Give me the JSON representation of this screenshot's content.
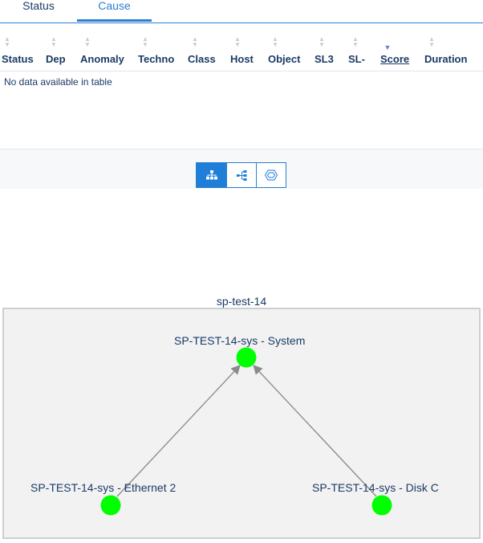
{
  "tabs": [
    {
      "label": "Status",
      "active": false
    },
    {
      "label": "Cause",
      "active": true
    }
  ],
  "table": {
    "columns": [
      {
        "label": "Status",
        "sorted": false
      },
      {
        "label": "Dep",
        "sorted": false
      },
      {
        "label": "Anomaly",
        "sorted": false
      },
      {
        "label": "Techno",
        "sorted": false
      },
      {
        "label": "Class",
        "sorted": false
      },
      {
        "label": "Host",
        "sorted": false
      },
      {
        "label": "Object",
        "sorted": false
      },
      {
        "label": "SL3",
        "sorted": false
      },
      {
        "label": "SL-",
        "sorted": false
      },
      {
        "label": "Score",
        "sorted": true
      },
      {
        "label": "Duration",
        "sorted": false
      }
    ],
    "empty_message": "No data available in table"
  },
  "view_buttons": [
    {
      "icon": "hierarchy-icon",
      "active": true
    },
    {
      "icon": "tree-horizontal-icon",
      "active": false
    },
    {
      "icon": "hexagon-network-icon",
      "active": false
    }
  ],
  "graph": {
    "group_label": "sp-test-14",
    "nodes": [
      {
        "id": "system",
        "label": "SP-TEST-14-sys - System",
        "color": "#00ff00"
      },
      {
        "id": "ethernet",
        "label": "SP-TEST-14-sys - Ethernet 2",
        "color": "#00ff00"
      },
      {
        "id": "disk",
        "label": "SP-TEST-14-sys - Disk C",
        "color": "#00ff00"
      }
    ],
    "edges": [
      {
        "from": "ethernet",
        "to": "system"
      },
      {
        "from": "disk",
        "to": "system"
      }
    ]
  },
  "colors": {
    "accent": "#1e7ed8",
    "text": "#1a3a66",
    "node": "#00ff00",
    "edge": "#8a8a8a"
  }
}
